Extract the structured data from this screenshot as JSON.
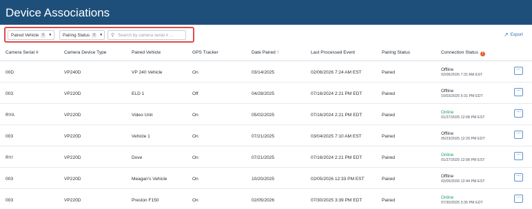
{
  "header": {
    "title": "Device Associations"
  },
  "filters": {
    "paired_vehicle": {
      "label": "Paired Vehicle",
      "count": "0"
    },
    "pairing_status": {
      "label": "Pairing Status",
      "count": "0"
    },
    "search_placeholder": "Search by camera serial # ..."
  },
  "toolbar": {
    "export_label": "Export"
  },
  "colors": {
    "header_bg": "#1e4f7a",
    "accent": "#2a6fb0",
    "online": "#1f9e5a",
    "highlight_border": "#e04848",
    "info_icon": "#e0622b"
  },
  "table": {
    "headers": {
      "camera_serial": "Camera Serial #",
      "device_type": "Camera Device Type",
      "paired_vehicle": "Paired Vehicle",
      "gps_tracker": "GPS Tracker",
      "date_paired": "Date Paired",
      "last_event": "Last Processed Event",
      "pairing_status": "Pairing Status",
      "connection_status": "Connection Status"
    },
    "sort_indicator": "↑",
    "rows": [
      {
        "serial": "00D",
        "type": "VP240D",
        "vehicle": "VP 240 Vehicle",
        "gps": "On",
        "date": "03/14/2025",
        "event": "02/06/2026 7:24 AM EST",
        "pairing": "Paired",
        "conn": "Offline",
        "conn_time": "02/06/2026 7:31 AM EST"
      },
      {
        "serial": "003",
        "type": "VP220D",
        "vehicle": "ELD 1",
        "gps": "Off",
        "date": "04/28/2025",
        "event": "07/16/2024 2:21 PM EDT",
        "pairing": "Paired",
        "conn": "Offline",
        "conn_time": "10/03/2025 5:31 PM EDT"
      },
      {
        "serial": "RYA",
        "type": "VP220D",
        "vehicle": "Video Unit",
        "gps": "On",
        "date": "05/02/2025",
        "event": "07/16/2024 2:21 PM EDT",
        "pairing": "Paired",
        "conn": "Online",
        "conn_time": "01/27/2025 12:08 PM EST"
      },
      {
        "serial": "003",
        "type": "VP220D",
        "vehicle": "Vehicle 1",
        "gps": "On",
        "date": "07/21/2025",
        "event": "03/04/2025 7:10 AM EST",
        "pairing": "Paired",
        "conn": "Offline",
        "conn_time": "05/23/2025 12:29 PM EDT"
      },
      {
        "serial": "RY/",
        "type": "VP220D",
        "vehicle": "Dove",
        "gps": "On",
        "date": "07/21/2025",
        "event": "07/16/2024 2:21 PM EDT",
        "pairing": "Paired",
        "conn": "Online",
        "conn_time": "01/27/2025 12:08 PM EST"
      },
      {
        "serial": "003",
        "type": "VP220D",
        "vehicle": "Meagan's Vehicle",
        "gps": "On",
        "date": "10/20/2025",
        "event": "02/05/2026 12:33 PM EST",
        "pairing": "Paired",
        "conn": "Offline",
        "conn_time": "02/05/2026 12:44 PM EST"
      },
      {
        "serial": "003",
        "type": "VP220D",
        "vehicle": "Preston F150",
        "gps": "On",
        "date": "02/05/2026",
        "event": "07/30/2025 3:39 PM EDT",
        "pairing": "Paired",
        "conn": "Online",
        "conn_time": "07/30/2025 3:35 PM EDT"
      }
    ],
    "row_action_icon": "more-horizontal-icon"
  }
}
